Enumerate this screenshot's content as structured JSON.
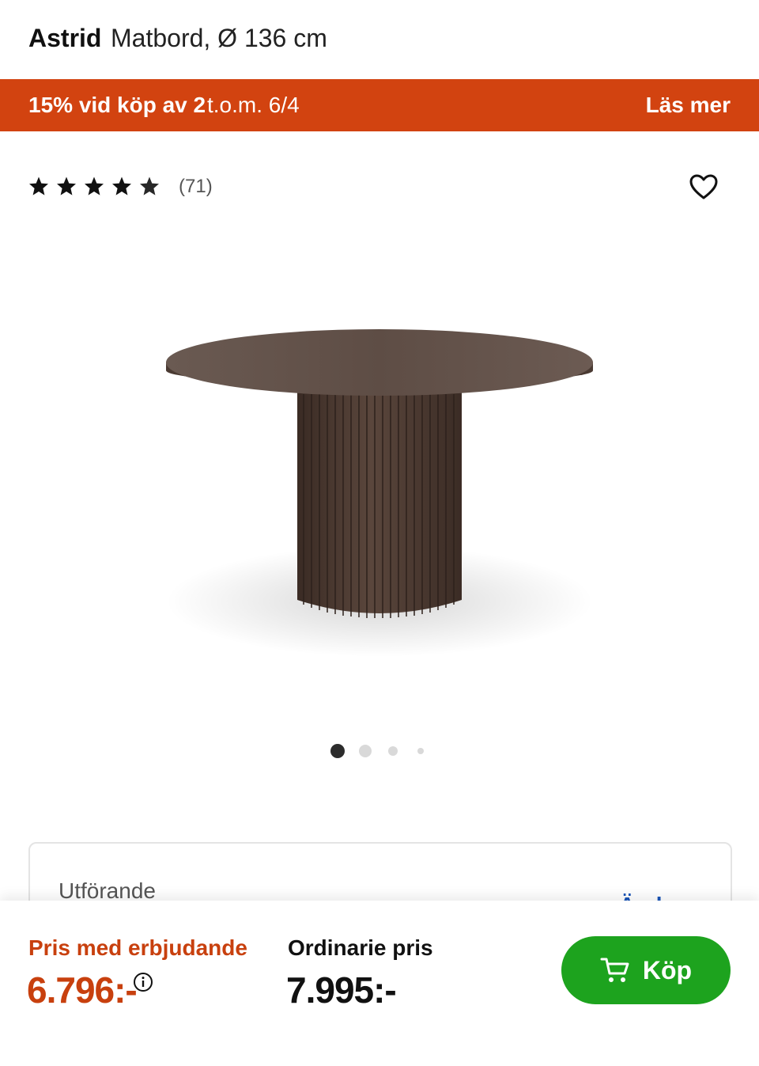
{
  "header": {
    "brand": "Astrid",
    "subtitle": "Matbord, Ø 136 cm"
  },
  "promo": {
    "text": "15% vid köp av 2",
    "date": "t.o.m. 6/4",
    "link": "Läs mer",
    "color": "#d24310"
  },
  "rating": {
    "stars": 4.5,
    "max": 5,
    "count": "(71)"
  },
  "favorite": {
    "icon": "heart-icon"
  },
  "gallery": {
    "image": "round dark wood dining table with fluted pedestal base",
    "count": 4,
    "active": 1
  },
  "variant": {
    "label": "Utförande",
    "change": "Ändra"
  },
  "buybar": {
    "offer_label": "Pris med erbjudande",
    "offer_price": "6.796:-",
    "regular_label": "Ordinarie pris",
    "regular_price": "7.995:-",
    "buy_label": "Köp",
    "accent": "#c8400e",
    "buy_color": "#1da31e"
  }
}
